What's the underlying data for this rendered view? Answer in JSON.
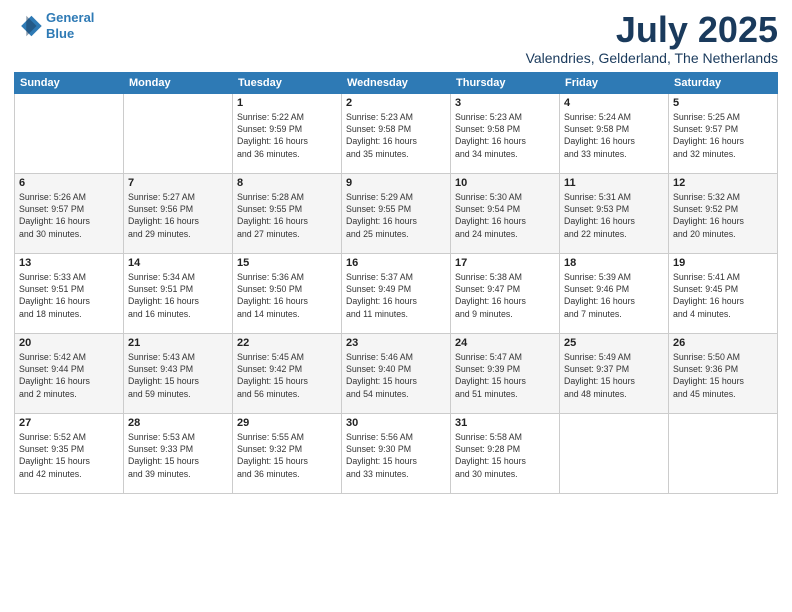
{
  "logo": {
    "line1": "General",
    "line2": "Blue"
  },
  "header": {
    "month": "July 2025",
    "location": "Valendries, Gelderland, The Netherlands"
  },
  "weekdays": [
    "Sunday",
    "Monday",
    "Tuesday",
    "Wednesday",
    "Thursday",
    "Friday",
    "Saturday"
  ],
  "weeks": [
    [
      {
        "day": "",
        "info": ""
      },
      {
        "day": "",
        "info": ""
      },
      {
        "day": "1",
        "info": "Sunrise: 5:22 AM\nSunset: 9:59 PM\nDaylight: 16 hours\nand 36 minutes."
      },
      {
        "day": "2",
        "info": "Sunrise: 5:23 AM\nSunset: 9:58 PM\nDaylight: 16 hours\nand 35 minutes."
      },
      {
        "day": "3",
        "info": "Sunrise: 5:23 AM\nSunset: 9:58 PM\nDaylight: 16 hours\nand 34 minutes."
      },
      {
        "day": "4",
        "info": "Sunrise: 5:24 AM\nSunset: 9:58 PM\nDaylight: 16 hours\nand 33 minutes."
      },
      {
        "day": "5",
        "info": "Sunrise: 5:25 AM\nSunset: 9:57 PM\nDaylight: 16 hours\nand 32 minutes."
      }
    ],
    [
      {
        "day": "6",
        "info": "Sunrise: 5:26 AM\nSunset: 9:57 PM\nDaylight: 16 hours\nand 30 minutes."
      },
      {
        "day": "7",
        "info": "Sunrise: 5:27 AM\nSunset: 9:56 PM\nDaylight: 16 hours\nand 29 minutes."
      },
      {
        "day": "8",
        "info": "Sunrise: 5:28 AM\nSunset: 9:55 PM\nDaylight: 16 hours\nand 27 minutes."
      },
      {
        "day": "9",
        "info": "Sunrise: 5:29 AM\nSunset: 9:55 PM\nDaylight: 16 hours\nand 25 minutes."
      },
      {
        "day": "10",
        "info": "Sunrise: 5:30 AM\nSunset: 9:54 PM\nDaylight: 16 hours\nand 24 minutes."
      },
      {
        "day": "11",
        "info": "Sunrise: 5:31 AM\nSunset: 9:53 PM\nDaylight: 16 hours\nand 22 minutes."
      },
      {
        "day": "12",
        "info": "Sunrise: 5:32 AM\nSunset: 9:52 PM\nDaylight: 16 hours\nand 20 minutes."
      }
    ],
    [
      {
        "day": "13",
        "info": "Sunrise: 5:33 AM\nSunset: 9:51 PM\nDaylight: 16 hours\nand 18 minutes."
      },
      {
        "day": "14",
        "info": "Sunrise: 5:34 AM\nSunset: 9:51 PM\nDaylight: 16 hours\nand 16 minutes."
      },
      {
        "day": "15",
        "info": "Sunrise: 5:36 AM\nSunset: 9:50 PM\nDaylight: 16 hours\nand 14 minutes."
      },
      {
        "day": "16",
        "info": "Sunrise: 5:37 AM\nSunset: 9:49 PM\nDaylight: 16 hours\nand 11 minutes."
      },
      {
        "day": "17",
        "info": "Sunrise: 5:38 AM\nSunset: 9:47 PM\nDaylight: 16 hours\nand 9 minutes."
      },
      {
        "day": "18",
        "info": "Sunrise: 5:39 AM\nSunset: 9:46 PM\nDaylight: 16 hours\nand 7 minutes."
      },
      {
        "day": "19",
        "info": "Sunrise: 5:41 AM\nSunset: 9:45 PM\nDaylight: 16 hours\nand 4 minutes."
      }
    ],
    [
      {
        "day": "20",
        "info": "Sunrise: 5:42 AM\nSunset: 9:44 PM\nDaylight: 16 hours\nand 2 minutes."
      },
      {
        "day": "21",
        "info": "Sunrise: 5:43 AM\nSunset: 9:43 PM\nDaylight: 15 hours\nand 59 minutes."
      },
      {
        "day": "22",
        "info": "Sunrise: 5:45 AM\nSunset: 9:42 PM\nDaylight: 15 hours\nand 56 minutes."
      },
      {
        "day": "23",
        "info": "Sunrise: 5:46 AM\nSunset: 9:40 PM\nDaylight: 15 hours\nand 54 minutes."
      },
      {
        "day": "24",
        "info": "Sunrise: 5:47 AM\nSunset: 9:39 PM\nDaylight: 15 hours\nand 51 minutes."
      },
      {
        "day": "25",
        "info": "Sunrise: 5:49 AM\nSunset: 9:37 PM\nDaylight: 15 hours\nand 48 minutes."
      },
      {
        "day": "26",
        "info": "Sunrise: 5:50 AM\nSunset: 9:36 PM\nDaylight: 15 hours\nand 45 minutes."
      }
    ],
    [
      {
        "day": "27",
        "info": "Sunrise: 5:52 AM\nSunset: 9:35 PM\nDaylight: 15 hours\nand 42 minutes."
      },
      {
        "day": "28",
        "info": "Sunrise: 5:53 AM\nSunset: 9:33 PM\nDaylight: 15 hours\nand 39 minutes."
      },
      {
        "day": "29",
        "info": "Sunrise: 5:55 AM\nSunset: 9:32 PM\nDaylight: 15 hours\nand 36 minutes."
      },
      {
        "day": "30",
        "info": "Sunrise: 5:56 AM\nSunset: 9:30 PM\nDaylight: 15 hours\nand 33 minutes."
      },
      {
        "day": "31",
        "info": "Sunrise: 5:58 AM\nSunset: 9:28 PM\nDaylight: 15 hours\nand 30 minutes."
      },
      {
        "day": "",
        "info": ""
      },
      {
        "day": "",
        "info": ""
      }
    ]
  ]
}
